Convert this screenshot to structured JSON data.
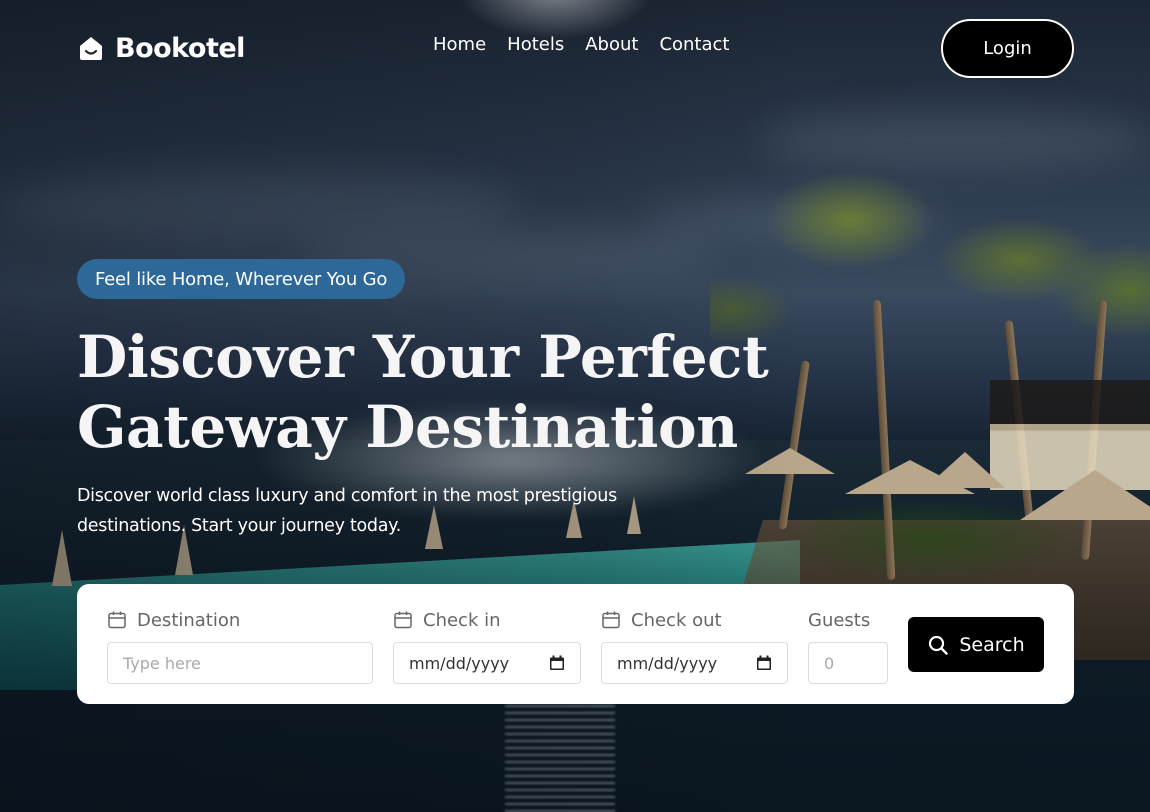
{
  "brand": {
    "name": "Bookotel",
    "logo_icon": "house-icon"
  },
  "nav": {
    "links": [
      "Home",
      "Hotels",
      "About",
      "Contact"
    ],
    "login_label": "Login"
  },
  "hero": {
    "tagline": "Feel like Home, Wherever You Go",
    "headline_line1": "Discover Your Perfect",
    "headline_line2": "Gateway Destination",
    "subtext_line1": "Discover world class luxury and comfort in the most prestigious",
    "subtext_line2": "destinations. Start your journey today."
  },
  "search": {
    "destination_label": "Destination",
    "destination_placeholder": "Type here",
    "checkin_label": "Check in",
    "checkin_value": "mm/dd/yyyy",
    "checkout_label": "Check out",
    "checkout_value": "mm/dd/yyyy",
    "guests_label": "Guests",
    "guests_placeholder": "0",
    "button_label": "Search"
  },
  "colors": {
    "tagline_bg": "#2e6898",
    "button_bg": "#000000",
    "card_bg": "#ffffff"
  }
}
